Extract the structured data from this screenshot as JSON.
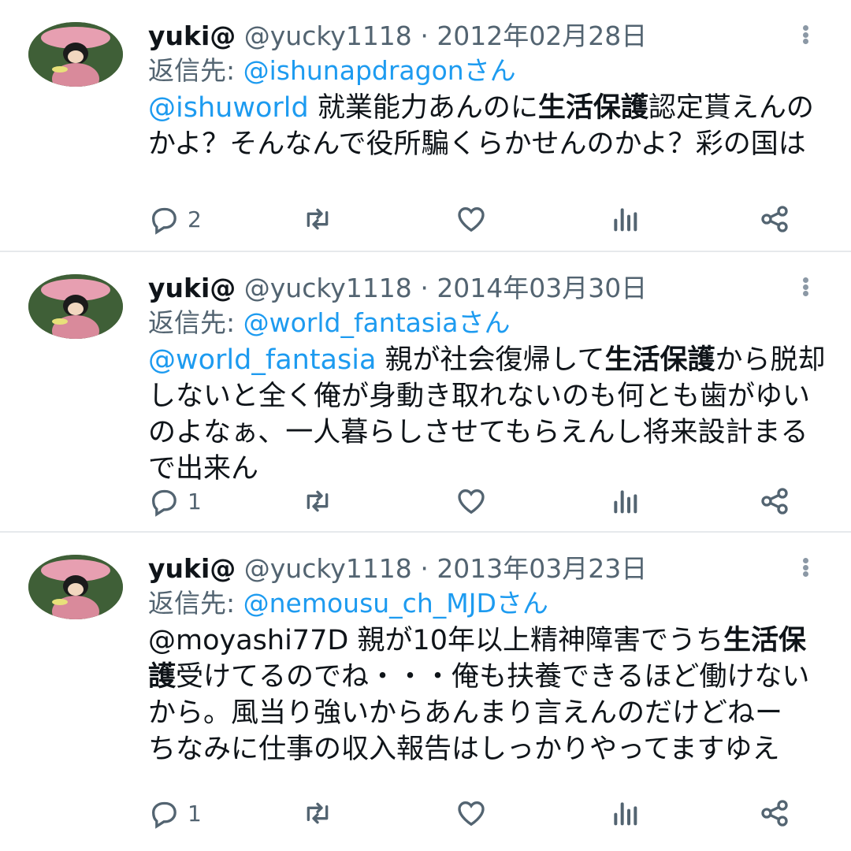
{
  "tweets": [
    {
      "name": "yuki@",
      "handle": "@yucky1118",
      "separator": "·",
      "date": "2012年02月28日",
      "reply_prefix": "返信先: ",
      "reply_to": "@ishunapdragonさん",
      "body_mention": "@ishuworld",
      "body_parts": [
        " 就業能力あんのに",
        "生活保護",
        "認定貰えんのかよ？そんなんで役所騙くらかせんのかよ？彩の国は"
      ],
      "reply_count": "2",
      "retweet_count": "",
      "like_count": ""
    },
    {
      "name": "yuki@",
      "handle": "@yucky1118",
      "separator": "·",
      "date": "2014年03月30日",
      "reply_prefix": "返信先: ",
      "reply_to": "@world_fantasiaさん",
      "body_mention": "@world_fantasia",
      "body_parts": [
        " 親が社会復帰して",
        "生活保護",
        "から脱却しないと全く俺が身動き取れないのも何とも歯がゆいのよなぁ、一人暮らしさせてもらえんし将来設計まるで出来ん"
      ],
      "reply_count": "1",
      "retweet_count": "",
      "like_count": ""
    },
    {
      "name": "yuki@",
      "handle": "@yucky1118",
      "separator": "·",
      "date": "2013年03月23日",
      "reply_prefix": "返信先: ",
      "reply_to": "@nemousu_ch_MJDさん",
      "body_mention": "",
      "body_parts": [
        "@moyashi77D 親が10年以上精神障害でうち",
        "生活保護",
        "受けてるのでね・・・俺も扶養できるほど働けないから。風当り強いからあんまり言えんのだけどねー　ちなみに仕事の収入報告はしっかりやってますゆえ"
      ],
      "reply_count": "1",
      "retweet_count": "",
      "like_count": ""
    }
  ],
  "icons": {
    "reply": "reply-icon",
    "retweet": "retweet-icon",
    "like": "heart-icon",
    "views": "views-icon",
    "share": "share-icon",
    "more": "more-icon"
  },
  "colors": {
    "link": "#1d9bf0",
    "meta": "#536471",
    "text": "#0f1419",
    "divider": "#e6e9ec"
  }
}
